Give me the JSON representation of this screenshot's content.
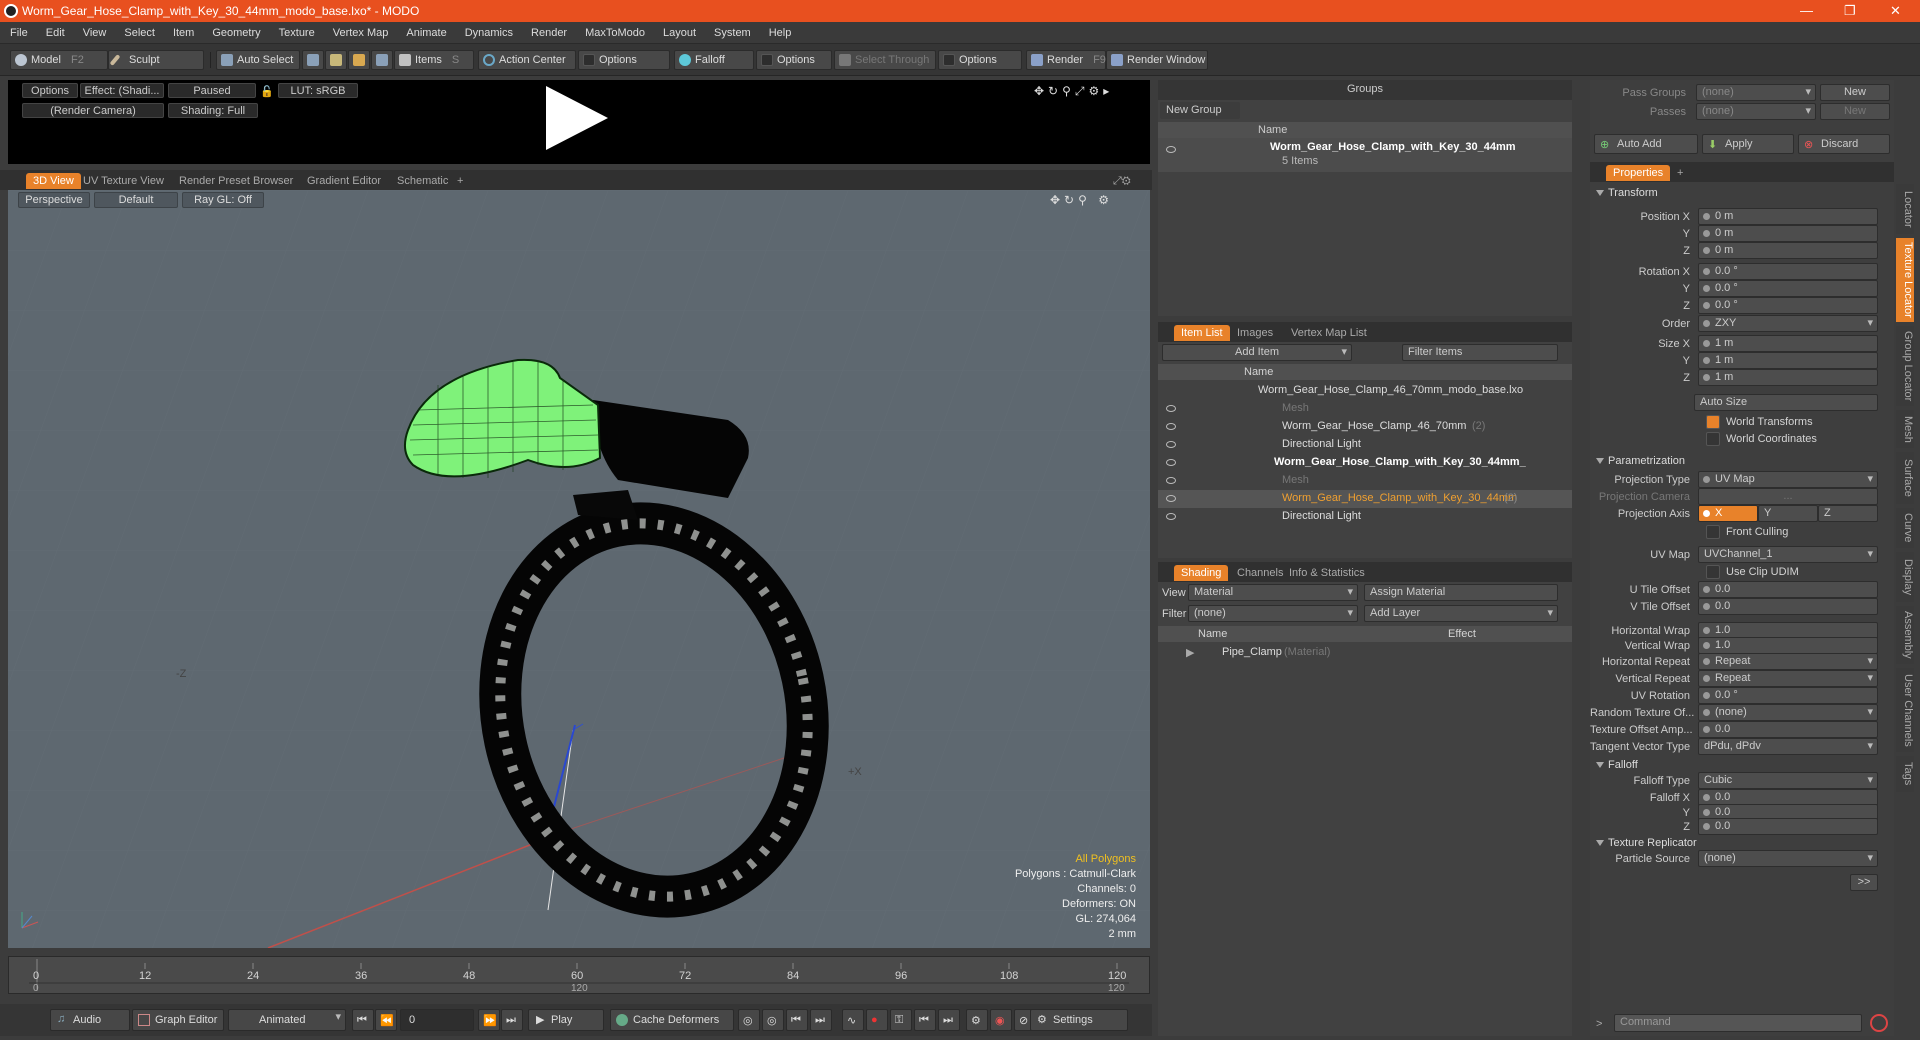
{
  "window": {
    "title": "Worm_Gear_Hose_Clamp_with_Key_30_44mm_modo_base.lxo* - MODO"
  },
  "menu": [
    "File",
    "Edit",
    "View",
    "Select",
    "Item",
    "Geometry",
    "Texture",
    "Vertex Map",
    "Animate",
    "Dynamics",
    "Render",
    "MaxToModo",
    "Layout",
    "System",
    "Help"
  ],
  "toolbar": {
    "model": "Model",
    "model_key": "F2",
    "sculpt": "Sculpt",
    "auto_select": "Auto Select",
    "items": "Items",
    "items_key": "S",
    "action_center": "Action Center",
    "options1": "Options",
    "falloff": "Falloff",
    "options2": "Options",
    "select_through": "Select Through",
    "options3": "Options",
    "render": "Render",
    "render_key": "F9",
    "render_window": "Render Window"
  },
  "preview": {
    "options": "Options",
    "effect": "Effect: (Shadi...",
    "paused": "Paused",
    "lut": "LUT: sRGB",
    "camera": "(Render Camera)",
    "shading": "Shading: Full"
  },
  "viewport_tabs": [
    "3D View",
    "UV Texture View",
    "Render Preset Browser",
    "Gradient Editor",
    "Schematic"
  ],
  "viewport": {
    "perspective": "Perspective",
    "default": "Default",
    "raygl": "Ray GL: Off",
    "hud": [
      "All Polygons",
      "Polygons : Catmull-Clark",
      "Channels: 0",
      "Deformers: ON",
      "GL: 274,064",
      "2 mm"
    ],
    "axis_neg_z": "-Z",
    "axis_pos_x": "+X"
  },
  "timeline": {
    "ticks": [
      "0",
      "12",
      "24",
      "36",
      "48",
      "60",
      "72",
      "84",
      "96",
      "108",
      "120"
    ],
    "bottom_ticks": [
      "0",
      "120",
      "120"
    ]
  },
  "bottom": {
    "audio": "Audio",
    "graph_editor": "Graph Editor",
    "animated": "Animated",
    "frame": "0",
    "play": "Play",
    "cache": "Cache Deformers",
    "settings": "Settings"
  },
  "groups": {
    "title": "Groups",
    "new_group": "New Group",
    "col_name": "Name",
    "item_name": "Worm_Gear_Hose_Clamp_with_Key_30_44mm",
    "item_count": "5 Items"
  },
  "itemlist": {
    "tabs": [
      "Item List",
      "Images",
      "Vertex Map List"
    ],
    "add_item": "Add Item",
    "filter": "Filter Items",
    "col_name": "Name",
    "rows": [
      {
        "label": "Worm_Gear_Hose_Clamp_46_70mm_modo_base.lxo",
        "indent": 0,
        "style": "normal"
      },
      {
        "label": "Mesh",
        "indent": 1,
        "style": "dim"
      },
      {
        "label": "Worm_Gear_Hose_Clamp_46_70mm",
        "suffix": "(2)",
        "indent": 1,
        "style": "normal"
      },
      {
        "label": "Directional Light",
        "indent": 1,
        "style": "normal"
      },
      {
        "label": "Worm_Gear_Hose_Clamp_with_Key_30_44mm_",
        "indent": 0,
        "style": "bold"
      },
      {
        "label": "Mesh",
        "indent": 1,
        "style": "dim"
      },
      {
        "label": "Worm_Gear_Hose_Clamp_with_Key_30_44mm",
        "suffix": "(2)",
        "indent": 1,
        "style": "selected"
      },
      {
        "label": "Directional Light",
        "indent": 1,
        "style": "normal"
      }
    ]
  },
  "shading": {
    "tabs": [
      "Shading",
      "Channels",
      "Info & Statistics"
    ],
    "view_label": "View",
    "view_value": "Material",
    "assign": "Assign Material",
    "filter_label": "Filter",
    "filter_value": "(none)",
    "add_layer": "Add Layer",
    "col_name": "Name",
    "col_effect": "Effect",
    "material": "Pipe_Clamp",
    "material_type": "(Material)"
  },
  "passes": {
    "pass_groups": "Pass Groups",
    "passes": "Passes",
    "none1": "(none)",
    "none2": "(none)",
    "new1": "New",
    "new2": "New"
  },
  "actions": {
    "auto_add": "Auto Add",
    "apply": "Apply",
    "discard": "Discard"
  },
  "properties": {
    "tab": "Properties",
    "transform": "Transform",
    "pos_x_l": "Position X",
    "y_l": "Y",
    "z_l": "Z",
    "pos_x": "0 m",
    "pos_y": "0 m",
    "pos_z": "0 m",
    "rot_x_l": "Rotation X",
    "rot_x": "0.0 °",
    "rot_y": "0.0 °",
    "rot_z": "0.0 °",
    "order_l": "Order",
    "order": "ZXY",
    "size_x_l": "Size X",
    "size_x": "1 m",
    "size_y": "1 m",
    "size_z": "1 m",
    "auto_size": "Auto Size",
    "world_transforms": "World Transforms",
    "world_coordinates": "World Coordinates",
    "parametrization": "Parametrization",
    "proj_type_l": "Projection Type",
    "proj_type": "UV Map",
    "proj_cam_l": "Projection Camera",
    "proj_cam": "...",
    "proj_axis_l": "Projection Axis",
    "axis_x": "X",
    "axis_y": "Y",
    "axis_z": "Z",
    "front_culling": "Front Culling",
    "uvmap_l": "UV Map",
    "uvmap": "UVChannel_1",
    "use_clip": "Use Clip UDIM",
    "utile_l": "U Tile Offset",
    "utile": "0.0",
    "vtile_l": "V Tile Offset",
    "vtile": "0.0",
    "hwrap_l": "Horizontal Wrap",
    "hwrap": "1.0",
    "vwrap_l": "Vertical Wrap",
    "vwrap": "1.0",
    "hrep_l": "Horizontal Repeat",
    "hrep": "Repeat",
    "vrep_l": "Vertical Repeat",
    "vrep": "Repeat",
    "uvrot_l": "UV Rotation",
    "uvrot": "0.0 °",
    "rand_l": "Random Texture Of...",
    "rand": "(none)",
    "toff_l": "Texture Offset Amp...",
    "toff": "0.0",
    "tan_l": "Tangent Vector Type",
    "tan": "dPdu, dPdv",
    "falloff": "Falloff",
    "ftype_l": "Falloff Type",
    "ftype": "Cubic",
    "fx_l": "Falloff X",
    "fx": "0.0",
    "fy": "0.0",
    "fz": "0.0",
    "replicator": "Texture Replicator",
    "psrc_l": "Particle Source",
    "psrc": "(none)",
    "more": ">>"
  },
  "side_tabs": [
    "Locator",
    "Texture Locator",
    "Group Locator",
    "Mesh",
    "Surface",
    "Curve",
    "Display",
    "Assembly",
    "User Channels",
    "Tags"
  ],
  "command": {
    "placeholder": "Command"
  }
}
